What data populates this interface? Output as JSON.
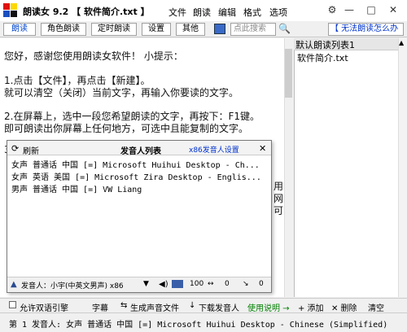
{
  "window": {
    "title": "朗读女 9.2  【 软件简介.txt 】",
    "controls": {
      "minimize": "—",
      "maximize": "□",
      "close": "✕",
      "help": "?"
    }
  },
  "menu": [
    "文件",
    "朗读",
    "编辑",
    "格式",
    "选项"
  ],
  "tabs": [
    "朗读",
    "角色朗读",
    "定时朗读",
    "设置",
    "其他"
  ],
  "search": {
    "placeholder": "点此搜索"
  },
  "notice": "【 无法朗读怎么办",
  "editor": {
    "lines": [
      "您好，感谢您使用朗读女软件！   小提示：",
      "",
      "1.点击【文件】，再点击【新建】。",
      "  就可以清空（关闭）当前文字，再输入你要读的文字。",
      "",
      "2.在屏幕上，选中一段您希望朗读的文字，再按下：F1键。",
      "  即可朗读出你屏幕上任何地方，可选中且能复制的文字。",
      "",
      "3"
    ],
    "partial_right": [
      "用",
      "网",
      "可"
    ]
  },
  "playlist": {
    "header": "默认朗读列表1",
    "items": [
      "软件简介.txt"
    ]
  },
  "popup": {
    "refresh": "刷新",
    "title": "发音人列表",
    "settings_link": "x86发音人设置",
    "close": "✕",
    "voices": [
      "女声 普通话 中国 [=] Microsoft Huihui Desktop - Ch...",
      "女声 英语 美国 [=] Microsoft Zira Desktop - Englis...",
      "男声 普通话 中国 [=] VW Liang"
    ],
    "footer": {
      "speaker_label": "发音人：小宇(中英文男声) x86",
      "volume": "100",
      "speed": "0",
      "pitch": "0"
    }
  },
  "toolbar": {
    "dual_engine": "允许双语引擎",
    "subtitle": "字幕",
    "generate": "生成声音文件",
    "download": "下载发音人",
    "help": "使用说明 →",
    "add": "+ 添加",
    "delete": "✕ 删除",
    "clear": "清空"
  },
  "status": "第 1 发音人: 女声 普通话 中国 [=] Microsoft Huihui Desktop - Chinese (Simplified)"
}
